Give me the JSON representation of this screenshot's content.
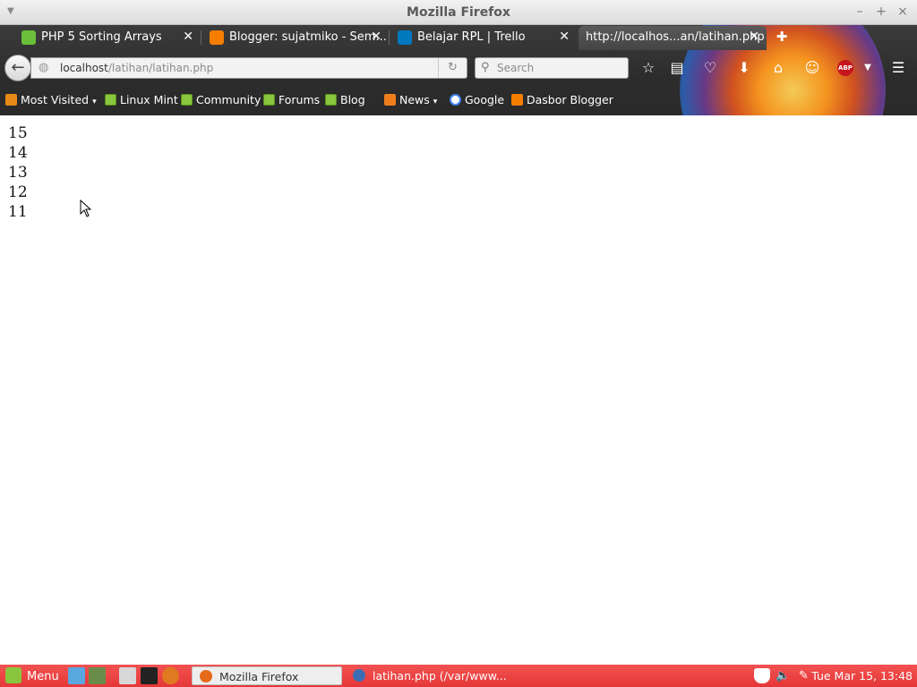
{
  "window": {
    "title": "Mozilla Firefox",
    "controls": [
      "–",
      "+",
      "×"
    ]
  },
  "tabs": [
    {
      "label": "PHP 5 Sorting Arrays",
      "icon": "w3schools-favicon",
      "active": false
    },
    {
      "label": "Blogger: sujatmiko - Sem...",
      "icon": "blogger-favicon",
      "active": false
    },
    {
      "label": "Belajar RPL | Trello",
      "icon": "trello-favicon",
      "active": false
    },
    {
      "label": "http://localhos...an/latihan.php",
      "icon": "",
      "active": true
    }
  ],
  "navbar": {
    "url_host": "localhost",
    "url_path": "/latihan/latihan.php",
    "search_placeholder": "Search",
    "adblock_label": "ABP"
  },
  "bookmarks": [
    {
      "label": "Most Visited",
      "icon": "folder-icon",
      "dropdown": true
    },
    {
      "label": "Linux Mint",
      "icon": "mint-icon"
    },
    {
      "label": "Community",
      "icon": "mint-icon"
    },
    {
      "label": "Forums",
      "icon": "mint-icon"
    },
    {
      "label": "Blog",
      "icon": "mint-icon"
    },
    {
      "label": "News",
      "icon": "rss-icon",
      "dropdown": true
    },
    {
      "label": "Google",
      "icon": "google-icon"
    },
    {
      "label": "Dasbor Blogger",
      "icon": "blogger-icon"
    }
  ],
  "page": {
    "lines": [
      "15",
      "14",
      "13",
      "12",
      "11"
    ]
  },
  "taskbar": {
    "menu_label": "Menu",
    "tasks": [
      {
        "label": "Mozilla Firefox",
        "active": true
      },
      {
        "label": "latihan.php (/var/www...",
        "active": false
      }
    ],
    "clock": "Tue Mar 15, 13:48"
  }
}
